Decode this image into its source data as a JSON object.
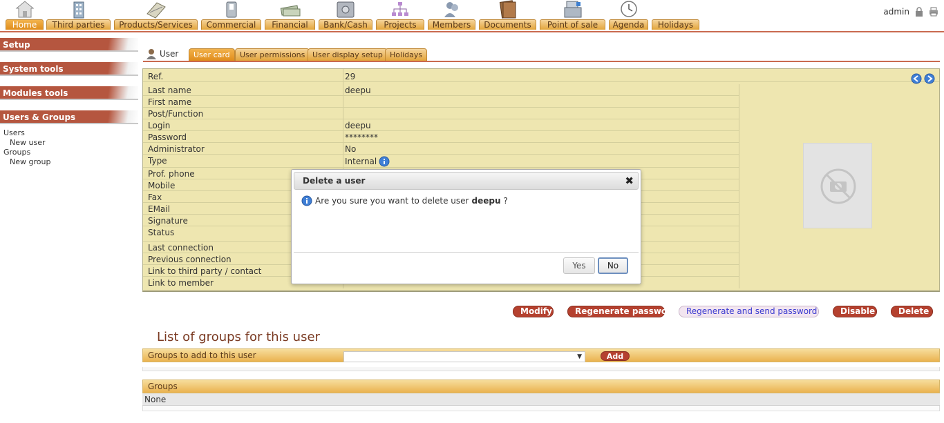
{
  "topbar": {
    "user": "admin",
    "menu": [
      {
        "label": "Home",
        "icon": "home-icon",
        "active": true
      },
      {
        "label": "Third parties",
        "icon": "building-icon"
      },
      {
        "label": "Products/Services",
        "icon": "products-icon"
      },
      {
        "label": "Commercial",
        "icon": "briefcase-icon"
      },
      {
        "label": "Financial",
        "icon": "banknotes-icon"
      },
      {
        "label": "Bank/Cash",
        "icon": "safe-icon"
      },
      {
        "label": "Projects",
        "icon": "org-chart-icon"
      },
      {
        "label": "Members",
        "icon": "members-icon"
      },
      {
        "label": "Documents",
        "icon": "folders-icon"
      },
      {
        "label": "Point of sale",
        "icon": "cash-register-icon"
      },
      {
        "label": "Agenda",
        "icon": "clock-icon"
      },
      {
        "label": "Holidays",
        "icon": "holidays-icon"
      }
    ]
  },
  "sidebar": {
    "sections": [
      {
        "title": "Setup"
      },
      {
        "title": "System tools"
      },
      {
        "title": "Modules tools"
      },
      {
        "title": "Users & Groups"
      }
    ],
    "links": [
      {
        "label": "Users"
      },
      {
        "label": "New user"
      },
      {
        "label": "Groups"
      },
      {
        "label": "New group"
      }
    ]
  },
  "tabs": {
    "title": "User",
    "items": [
      {
        "label": "User card",
        "active": true
      },
      {
        "label": "User permissions"
      },
      {
        "label": "User display setup"
      },
      {
        "label": "Holidays"
      }
    ]
  },
  "card": {
    "rows": [
      {
        "label": "Ref.",
        "value": "29"
      },
      {
        "label": "Last name",
        "value": "deepu"
      },
      {
        "label": "First name",
        "value": ""
      },
      {
        "label": "Post/Function",
        "value": ""
      },
      {
        "label": "Login",
        "value": "deepu"
      },
      {
        "label": "Password",
        "value": "********"
      },
      {
        "label": "Administrator",
        "value": "No"
      },
      {
        "label": "Type",
        "value": "Internal"
      },
      {
        "label": "Prof. phone",
        "value": ""
      },
      {
        "label": "Mobile",
        "value": ""
      },
      {
        "label": "Fax",
        "value": ""
      },
      {
        "label": "EMail",
        "value": ""
      },
      {
        "label": "Signature",
        "value": ""
      },
      {
        "label": "Status",
        "value": ""
      },
      {
        "label": "Last connection",
        "value": ""
      },
      {
        "label": "Previous connection",
        "value": ""
      },
      {
        "label": "Link to third party / contact",
        "value": ""
      },
      {
        "label": "Link to member",
        "value": ""
      }
    ]
  },
  "actions": {
    "modify": "Modify",
    "regenerate": "Regenerate password",
    "regenerate_send": "Regenerate and send password",
    "disable": "Disable",
    "delete": "Delete"
  },
  "groups": {
    "list_title": "List of groups for this user",
    "add_label": "Groups to add to this user",
    "add_button": "Add",
    "header": "Groups",
    "empty": "None"
  },
  "modal": {
    "title": "Delete a user",
    "message": "Are you sure you want to delete user",
    "username": "deepu",
    "suffix": "?",
    "yes": "Yes",
    "no": "No"
  },
  "colors": {
    "accent": "#b5412f",
    "tab": "#e3a53b",
    "card_bg": "#eee6b0"
  }
}
